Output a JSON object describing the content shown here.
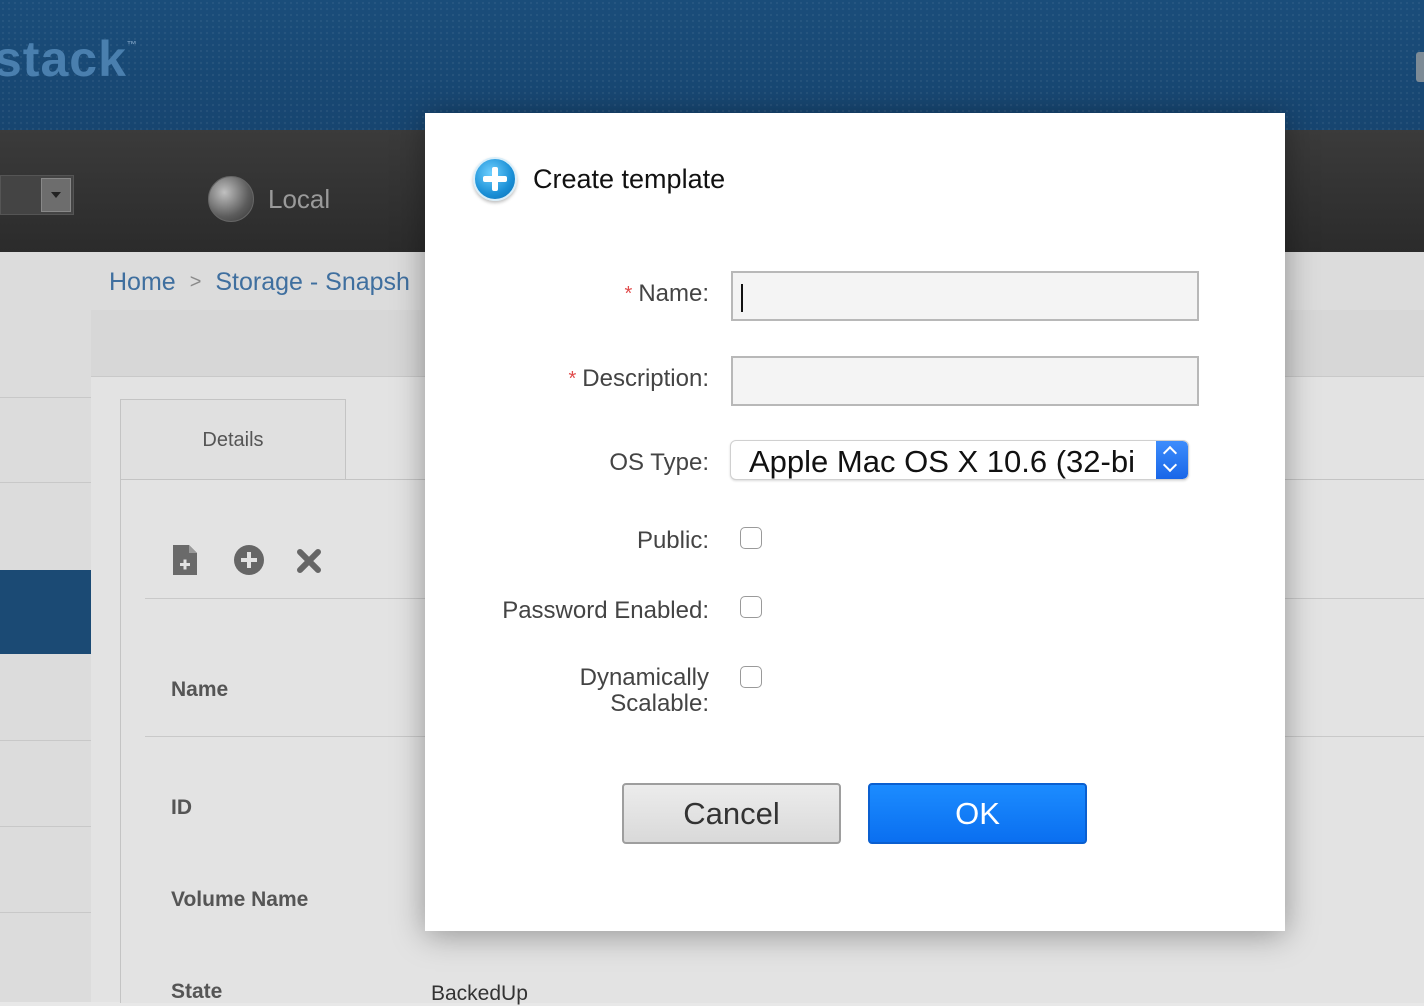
{
  "app": {
    "logo_text": "stack",
    "logo_tm": "™",
    "zone_label": "Local"
  },
  "breadcrumb": {
    "home": "Home",
    "separator": ">",
    "current": "Storage - Snapsh"
  },
  "details": {
    "tab_label": "Details",
    "action_icons": [
      "create-template-icon",
      "add-circle-icon",
      "delete-x-icon"
    ],
    "fields": [
      {
        "label": "Name",
        "value": ""
      },
      {
        "label": "ID",
        "value": ""
      },
      {
        "label": "Volume Name",
        "value": ""
      },
      {
        "label": "State",
        "value": "BackedUp"
      }
    ]
  },
  "dialog": {
    "title": "Create template",
    "required_marker": "*",
    "fields": {
      "name": {
        "label": "Name:",
        "value": "",
        "required": true
      },
      "description": {
        "label": "Description:",
        "value": "",
        "required": true
      },
      "os_type": {
        "label": "OS Type:",
        "value": "Apple Mac OS X 10.6 (32-bi"
      },
      "public": {
        "label": "Public:",
        "checked": false
      },
      "password_enabled": {
        "label": "Password Enabled:",
        "checked": false
      },
      "dynamically_scalable": {
        "label_line1": "Dynamically",
        "label_line2": "Scalable:",
        "checked": false
      }
    },
    "buttons": {
      "cancel": "Cancel",
      "ok": "OK"
    }
  },
  "colors": {
    "header_blue": "#1a4d7a",
    "nav_dark": "#2f2f2f",
    "ok_blue": "#0a6ff0",
    "required_red": "#e04b4b"
  }
}
